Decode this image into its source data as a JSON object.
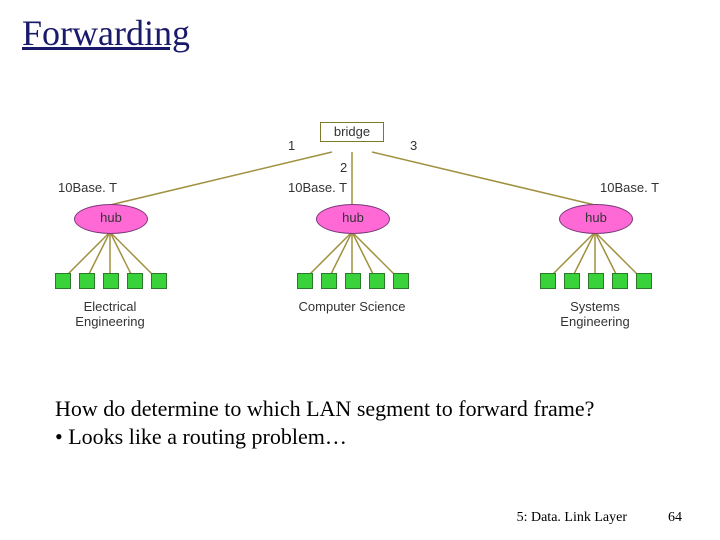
{
  "title": "Forwarding",
  "body": {
    "q": "How do determine to which LAN segment to forward frame?",
    "bullet": "• Looks like a routing problem…"
  },
  "footer": {
    "section": "5: Data. Link Layer",
    "page": "64"
  },
  "diagram": {
    "bridge_label": "bridge",
    "port1": "1",
    "port2": "2",
    "port3": "3",
    "link_tech": "10Base. T",
    "hub_label": "hub",
    "dept_ee": "Electrical Engineering",
    "dept_cs": "Computer Science",
    "dept_se": "Systems Engineering"
  }
}
